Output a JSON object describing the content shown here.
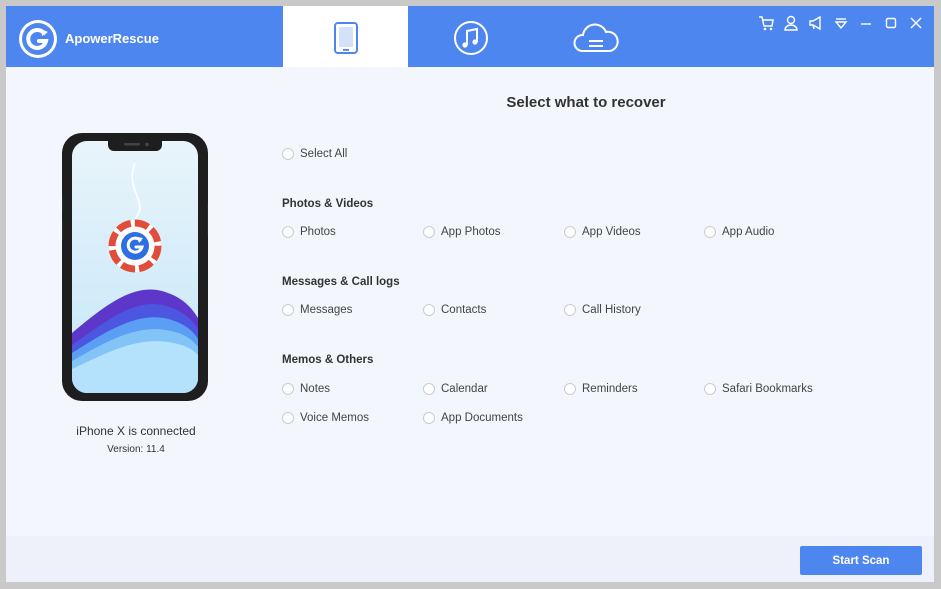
{
  "app": {
    "title": "ApowerRescue"
  },
  "header": {
    "tabs": [
      {
        "icon": "smartphone-icon",
        "active": true
      },
      {
        "icon": "music-note-icon",
        "active": false
      },
      {
        "icon": "cloud-icon",
        "active": false
      }
    ],
    "toolbar_icons": [
      "cart-icon",
      "user-icon",
      "megaphone-icon",
      "menu-icon",
      "minimize-icon",
      "maximize-icon",
      "close-icon"
    ]
  },
  "device": {
    "status": "iPhone X is connected",
    "version": "Version: 11.4"
  },
  "main": {
    "title": "Select what to recover",
    "select_all": "Select All",
    "sections": [
      {
        "title": "Photos & Videos",
        "items": [
          "Photos",
          "App Photos",
          "App Videos",
          "App Audio"
        ]
      },
      {
        "title": "Messages & Call logs",
        "items": [
          "Messages",
          "Contacts",
          "Call History"
        ]
      },
      {
        "title": "Memos & Others",
        "items": [
          "Notes",
          "Calendar",
          "Reminders",
          "Safari Bookmarks",
          "Voice Memos",
          "App Documents"
        ]
      }
    ]
  },
  "footer": {
    "start_scan": "Start Scan"
  },
  "colors": {
    "accent": "#4e86f0",
    "background": "#f3f6fd"
  }
}
